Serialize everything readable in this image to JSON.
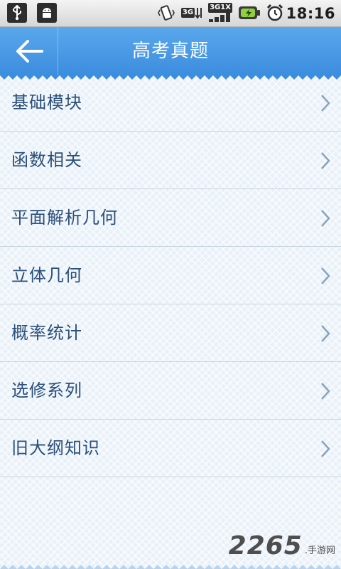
{
  "status_bar": {
    "time": "18:16",
    "network_label": "3G",
    "network2_label": "3G1X"
  },
  "header": {
    "title": "高考真题",
    "back_icon": "arrow-left-icon"
  },
  "menu": {
    "items": [
      {
        "label": "基础模块"
      },
      {
        "label": "函数相关"
      },
      {
        "label": "平面解析几何"
      },
      {
        "label": "立体几何"
      },
      {
        "label": "概率统计"
      },
      {
        "label": "选修系列"
      },
      {
        "label": "旧大纲知识"
      }
    ]
  },
  "watermark": {
    "number": "2265",
    "text": ".手游网"
  },
  "colors": {
    "accent": "#4a9ae6",
    "item_text": "#2b4f7a",
    "chevron": "#8aa3bb",
    "divider": "#c9d5df",
    "background": "#e9f1f8"
  }
}
